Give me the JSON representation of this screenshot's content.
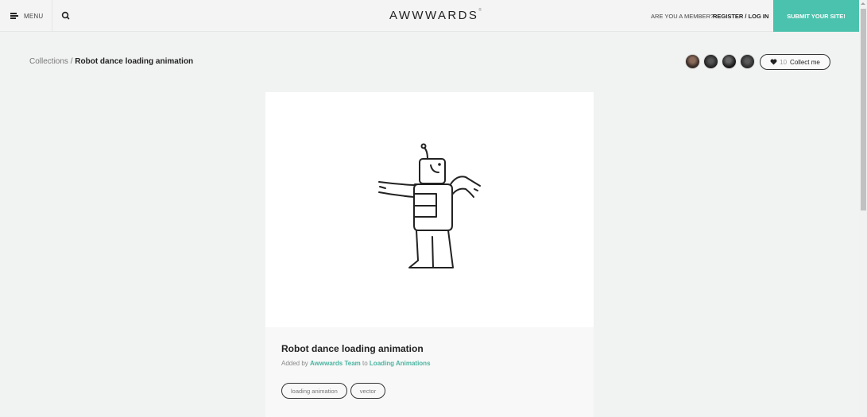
{
  "header": {
    "menu_label": "MENU",
    "logo": "AWWWARDS",
    "logo_mark": "®",
    "member_prompt": "ARE YOU A MEMBER?",
    "register_label": "REGISTER / LOG IN",
    "submit_label": "SUBMIT YOUR SITE!",
    "accent_color": "#4bc2ad"
  },
  "breadcrumb": {
    "parent": "Collections",
    "separator": "/",
    "current": "Robot dance loading animation"
  },
  "collectors": {
    "avatars": [
      {
        "name": "collector-1",
        "color": "#4a3b35"
      },
      {
        "name": "collector-2",
        "color": "#2e2e2e"
      },
      {
        "name": "collector-3",
        "color": "#262626"
      },
      {
        "name": "collector-4",
        "color": "#333333"
      }
    ],
    "count": "10",
    "collect_label": "Collect me"
  },
  "card": {
    "title": "Robot dance loading animation",
    "added_by_prefix": "Added by",
    "author": "Awwwards Team",
    "to_word": "to",
    "collection": "Loading Animations",
    "tags": [
      "loading animation",
      "vector"
    ]
  }
}
